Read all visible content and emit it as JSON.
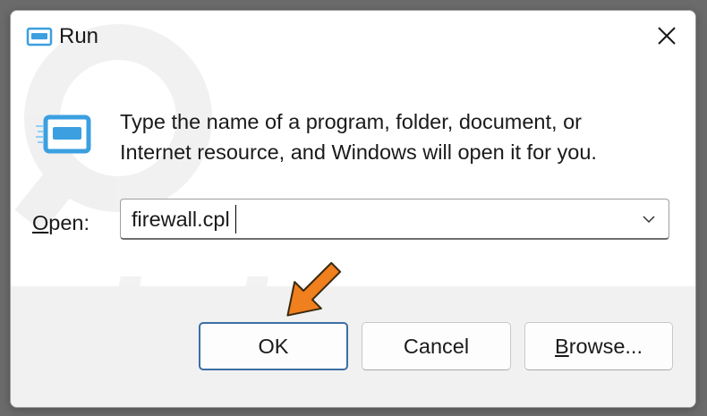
{
  "window": {
    "title": "Run",
    "close_label": "Close"
  },
  "body": {
    "description_line1": "Type the name of a program, folder, document, or",
    "description_line2": "Internet resource, and Windows will open it for you."
  },
  "open": {
    "label_accel": "O",
    "label_rest": "pen:",
    "value": "firewall.cpl"
  },
  "buttons": {
    "ok": "OK",
    "cancel": "Cancel",
    "browse_accel": "B",
    "browse_rest": "rowse..."
  },
  "watermark": {
    "text": "risk.com"
  },
  "colors": {
    "accent": "#3d6ea5",
    "arrow": "#f07f1e",
    "icon_blue": "#3b9fe0"
  },
  "icons": {
    "title": "run-icon",
    "body": "run-icon",
    "close": "close-icon",
    "dropdown": "chevron-down-icon",
    "pointer": "arrow-pointer-icon"
  }
}
